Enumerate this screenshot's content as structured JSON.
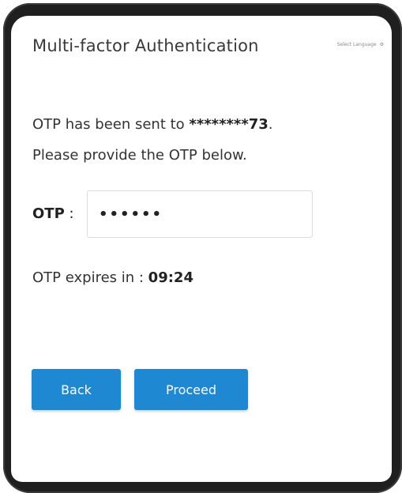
{
  "header": {
    "title": "Multi-factor Authentication",
    "language_label": "Select Language",
    "language_glyph": "⚙"
  },
  "message": {
    "line1_prefix": "OTP has been sent to ",
    "masked_number": "********73",
    "line1_suffix": ".",
    "line2": "Please provide the OTP below."
  },
  "otp": {
    "label": "OTP",
    "separator": " : ",
    "value": "••••••"
  },
  "expiry": {
    "prefix": "OTP expires in : ",
    "time": "09:24"
  },
  "buttons": {
    "back_label": "Back",
    "proceed_label": "Proceed"
  },
  "colors": {
    "button": "#1e88d2",
    "bezel": "#1f1f1f"
  }
}
